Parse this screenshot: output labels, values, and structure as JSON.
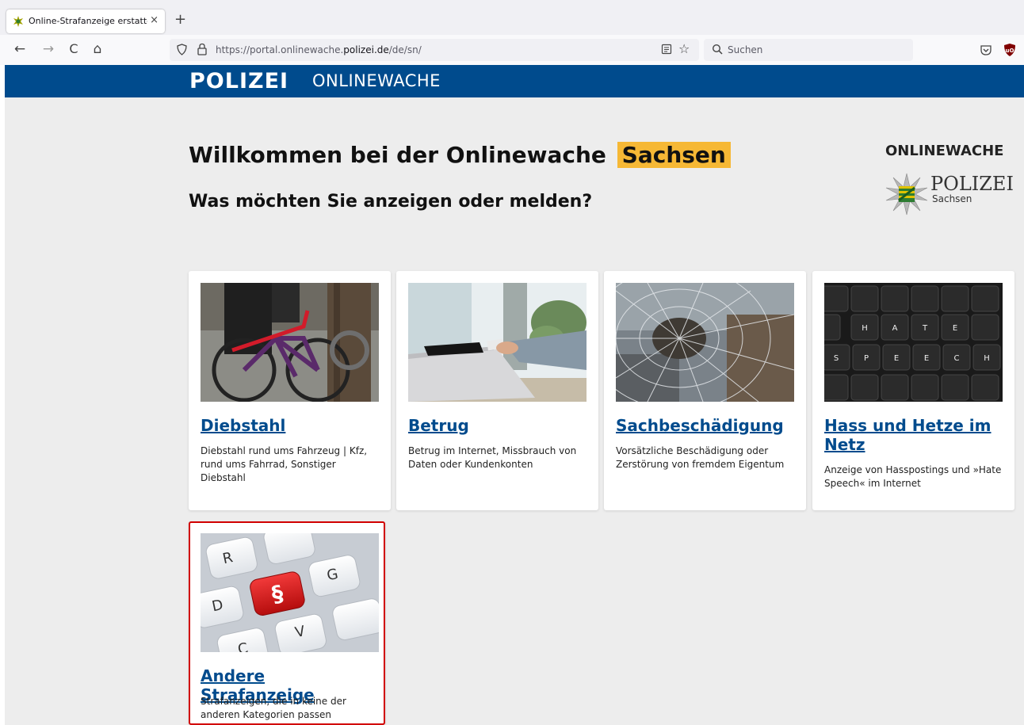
{
  "browser": {
    "tab_title": "Online-Strafanzeige erstatten –  ",
    "tab_close": "×",
    "new_tab": "+",
    "nav_back": "←",
    "nav_forward": "→",
    "nav_reload": "C",
    "nav_home": "⌂",
    "url_prefix": "https://portal.onlinewache.",
    "url_domain": "polizei.de",
    "url_suffix": "/de/sn/",
    "bookmark_star": "☆",
    "search_placeholder": "Suchen"
  },
  "header": {
    "brand": "POLIZEI",
    "subtitle": "ONLINEWACHE"
  },
  "welcome": {
    "text": "Willkommen bei der Onlinewache",
    "state": "Sachsen"
  },
  "question": "Was möchten Sie anzeigen oder melden?",
  "logo": {
    "title": "ONLINEWACHE",
    "polizei": "POLIZEI",
    "state": "Sachsen"
  },
  "cards": [
    {
      "title": "Diebstahl",
      "description": "Diebstahl rund ums Fahrzeug | Kfz, rund ums Fahrrad, Sonstiger Diebstahl"
    },
    {
      "title": "Betrug",
      "description": "Betrug im Internet, Missbrauch von Daten oder Kundenkonten"
    },
    {
      "title": "Sachbeschädigung",
      "description": "Vorsätzliche Beschädigung oder Zerstörung von fremdem Eigentum"
    },
    {
      "title": "Hass und Hetze im Netz",
      "description": "Anzeige von Hasspostings und »Hate Speech« im Internet"
    },
    {
      "title": "Andere Strafanzeige",
      "description": "Strafanzeigen, die in keine der anderen Kategorien passen"
    }
  ],
  "keyboard_letters": {
    "hate": [
      "H",
      "A",
      "T",
      "E"
    ],
    "speech": [
      "S",
      "P",
      "E",
      "E",
      "C",
      "H"
    ],
    "other": [
      "R",
      "G",
      "D",
      "§",
      "V",
      "C"
    ]
  },
  "colors": {
    "police_blue": "#004b8d",
    "highlight": "#f6b835",
    "selection": "#d10000"
  }
}
